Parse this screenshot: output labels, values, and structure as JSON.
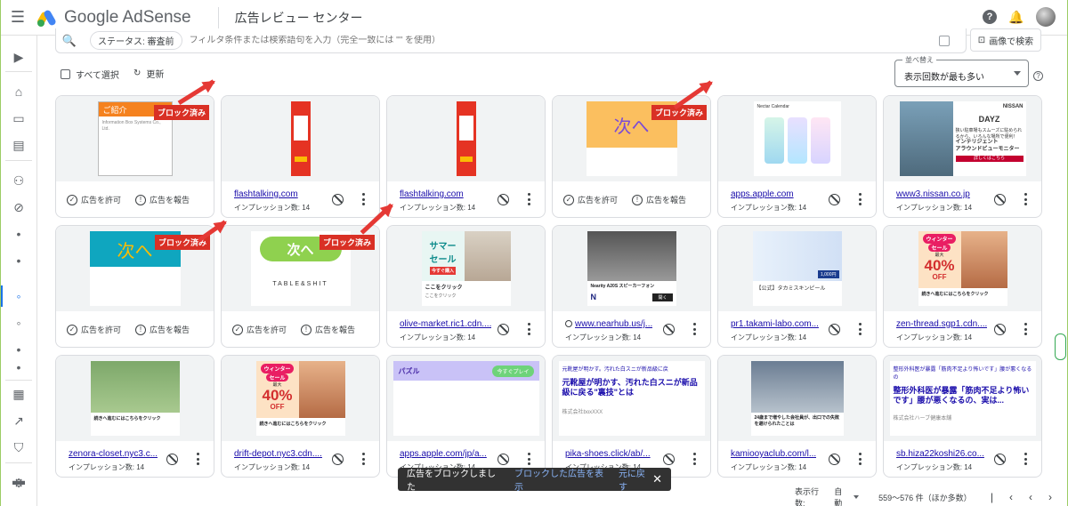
{
  "app": {
    "name": "Google AdSense",
    "page_title": "広告レビュー センター"
  },
  "header": {
    "help_icon": "help-icon",
    "bell_icon": "bell-icon"
  },
  "filter": {
    "chip": "ステータス: 審査前",
    "placeholder": "フィルタ条件または検索語句を入力（完全一致には \"\" を使用）",
    "image_search": "画像で検索"
  },
  "toolbar": {
    "select_all": "すべて選択",
    "refresh": "更新"
  },
  "sort": {
    "label": "並べ替え",
    "value": "表示回数が最も多い"
  },
  "actions": {
    "allow": "広告を許可",
    "report": "広告を報告",
    "blocked": "ブロック済み"
  },
  "cards": [
    {
      "type": "blocked",
      "thumb": "gokoukai"
    },
    {
      "domain": "flashtalking.com",
      "impr": "インプレッション数: 14",
      "thumb": "redtall"
    },
    {
      "domain": "flashtalking.com",
      "impr": "インプレッション数: 14",
      "thumb": "redtall"
    },
    {
      "type": "blocked",
      "thumb": "tsugihe-orange"
    },
    {
      "domain": "apps.apple.com",
      "impr": "インプレッション数: 14",
      "thumb": "apple"
    },
    {
      "domain": "www3.nissan.co.jp",
      "impr": "インプレッション数: 14",
      "thumb": "nissan"
    },
    {
      "type": "blocked",
      "thumb": "tsugihe-teal"
    },
    {
      "type": "blocked",
      "thumb": "tsugihe-green"
    },
    {
      "domain": "olive-market.ric1.cdn....",
      "impr": "インプレッション数: 14",
      "thumb": "summer"
    },
    {
      "domain": "www.nearhub.us/j...",
      "impr": "インプレッション数: 14",
      "thumb": "nearity",
      "play": true
    },
    {
      "domain": "pr1.takami-labo.com...",
      "impr": "インプレッション数: 14",
      "thumb": "takami"
    },
    {
      "domain": "zen-thread.sgp1.cdn....",
      "impr": "インプレッション数: 14",
      "thumb": "winter"
    },
    {
      "domain": "zenora-closet.nyc3.c...",
      "impr": "インプレッション数: 14",
      "thumb": "zenora"
    },
    {
      "domain": "drift-depot.nyc3.cdn....",
      "impr": "インプレッション数: 14",
      "thumb": "winter"
    },
    {
      "domain": "apps.apple.com/jp/a...",
      "impr": "インプレッション数: 14",
      "thumb": "puzzle"
    },
    {
      "domain": "pika-shoes.click/ab/...",
      "impr": "インプレッション数: 14",
      "thumb": "shoes"
    },
    {
      "domain": "kamiooyaclub.com/l...",
      "impr": "インプレッション数: 14",
      "thumb": "kamioya"
    },
    {
      "domain": "sb.hiza22koshi26.co...",
      "impr": "インプレッション数: 14",
      "thumb": "hiza"
    }
  ],
  "thumb_text": {
    "gokoukai": "ご紹介",
    "gokoukai_small": "Information Box Systems Co., Ltd.",
    "tsugihe": "次へ",
    "table_shit": "TABLE&SHIT",
    "summer_1": "サマー",
    "summer_2": "セール",
    "summer_3": "今すぐ購入",
    "summer_click": "ここをクリック",
    "summer_sub": "ここをクリック",
    "nearity": "Nearity A20S スピーカーフォン",
    "nearity_btn": "開く",
    "takami": "【公式】タカミスキンピール",
    "takami_price": "1,000円",
    "winter_1": "ウィンター",
    "winter_2": "セール",
    "winter_max": "最大",
    "winter_pct": "40%",
    "winter_off": "OFF",
    "winter_cta": "続きへ進むにはこちらをクリック",
    "zenora_cta": "続きへ進むにはこちらをクリック",
    "puzzle_title": "パズル",
    "puzzle_btn": "今すぐプレイ",
    "shoes_head": "元靴屋が明かす。汚れた白スニが新品級に戻",
    "shoes_title": "元靴屋が明かす、汚れた白スニが新品級に戻る\"裏技\"とは",
    "shoes_co": "株式会社boxXXX",
    "kamioya_text": "24歳まで増やした会社員が、出口での失敗を避けられたことは",
    "hiza_head": "整形外科医が暴露「筋肉不足より怖いです」腰が悪くなるの",
    "hiza_title": "整形外科医が暴露「筋肉不足より怖いです」腰が悪くなるの、実は...",
    "hiza_co": "株式会社ハーブ健康本舗",
    "apple_name": "Nectar Calendar",
    "nissan_line1": "狭い駐車場もスムーズに駐められるから、いろんな場所で便利！",
    "nissan_line2": "インテリジェント",
    "nissan_line3": "アラウンドビューモニター",
    "nissan_btn": "詳しくはこちら",
    "nissan_logo": "NISSAN",
    "nissan_model": "DAYZ"
  },
  "snackbar": {
    "message": "広告をブロックしました",
    "link1": "ブロックした広告を表示",
    "link2": "元に戻す"
  },
  "pager": {
    "rows_label": "表示行数:",
    "rows_value": "自動",
    "range": "559〜576 件（ほか多数）"
  },
  "colors": {
    "accent": "#1a73e8",
    "blocked": "#d93025",
    "link": "#1a0dab"
  }
}
